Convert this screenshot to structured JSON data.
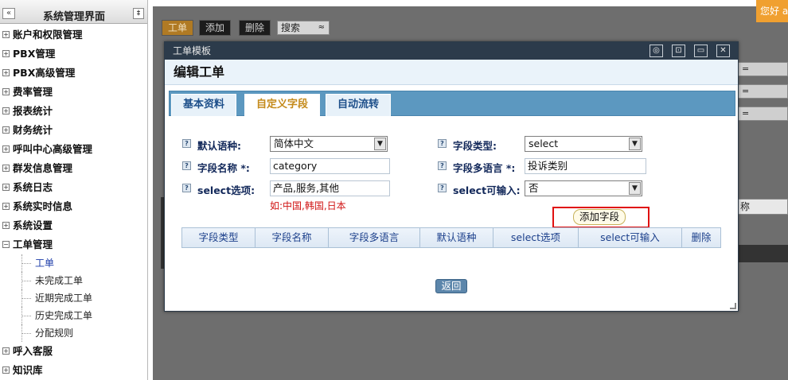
{
  "sidebar": {
    "title": "系统管理界面",
    "collapse_icon": "«",
    "pin_icon": "‡",
    "items": [
      {
        "label": "账户和权限管理",
        "toggle": "+"
      },
      {
        "label": "PBX管理",
        "toggle": "+"
      },
      {
        "label": "PBX高级管理",
        "toggle": "+"
      },
      {
        "label": "费率管理",
        "toggle": "+"
      },
      {
        "label": "报表统计",
        "toggle": "+"
      },
      {
        "label": "财务统计",
        "toggle": "+"
      },
      {
        "label": "呼叫中心高级管理",
        "toggle": "+"
      },
      {
        "label": "群发信息管理",
        "toggle": "+"
      },
      {
        "label": "系统日志",
        "toggle": "+"
      },
      {
        "label": "系统实时信息",
        "toggle": "+"
      },
      {
        "label": "系统设置",
        "toggle": "+"
      },
      {
        "label": "工单管理",
        "toggle": "−"
      }
    ],
    "subitems": [
      "工单",
      "未完成工单",
      "近期完成工单",
      "历史完成工单",
      "分配规则"
    ],
    "after_items": [
      {
        "label": "呼入客服",
        "toggle": "+"
      },
      {
        "label": "知识库",
        "toggle": "+"
      }
    ]
  },
  "background": {
    "buttons": [
      "工单",
      "添加",
      "删除"
    ],
    "search_label": "搜索",
    "search_icon": "≈",
    "right_rows": [
      "=",
      "=",
      "="
    ],
    "strip_text": "称",
    "hello": "您好 a"
  },
  "modal": {
    "window_title": "工单模板",
    "controls": [
      "◎",
      "⊡",
      "▭",
      "✕"
    ],
    "heading": "编辑工单",
    "tabs": [
      "基本资料",
      "自定义字段",
      "自动流转"
    ],
    "active_tab": 1,
    "help_glyph": "?",
    "select_arrow": "▼",
    "fields": {
      "default_lang_label": "默认语种:",
      "default_lang_value": "简体中文",
      "field_name_label": "字段名称 *:",
      "field_name_value": "category",
      "select_options_label": "select选项:",
      "select_options_value": "产品,服务,其他",
      "select_options_hint": "如:中国,韩国,日本",
      "field_type_label": "字段类型:",
      "field_type_value": "select",
      "field_multilang_label": "字段多语言 *:",
      "field_multilang_value": "投诉类别",
      "select_input_label": "select可输入:",
      "select_input_value": "否"
    },
    "add_field_button": "添加字段",
    "grid_columns": [
      "字段类型",
      "字段名称",
      "字段多语言",
      "默认语种",
      "select选项",
      "select可输入",
      "删除"
    ],
    "back_button": "返回"
  }
}
